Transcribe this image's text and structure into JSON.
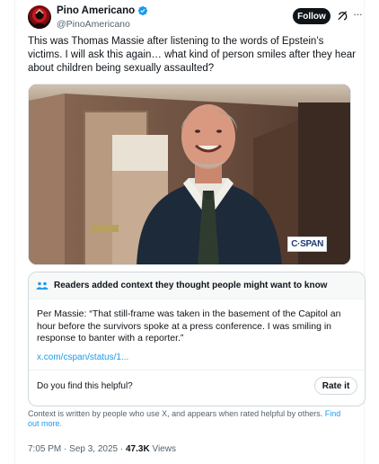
{
  "tweet": {
    "author_name": "Pino Americano",
    "author_handle": "@PinoAmericano",
    "follow_label": "Follow",
    "text": "This was Thomas Massie after listening to the words of Epstein’s victims. I will ask this again… what kind of person smiles after they hear about children being sexually assaulted?",
    "media_watermark": "C·SPAN",
    "time": "7:05 PM",
    "date": "Sep 3, 2025",
    "views_count": "47.3K",
    "views_label": "Views",
    "separator": "·"
  },
  "community_note": {
    "title": "Readers added context they thought people might want to know",
    "body": "Per Massie: “That still-frame was taken in the basement of the Capitol an hour before the survivors spoke at a press conference. I was smiling in response to banter with a reporter.”",
    "link": "x.com/cspan/status/1...",
    "helpful_question": "Do you find this helpful?",
    "rate_label": "Rate it",
    "footer_text": "Context is written by people who use X, and appears when rated helpful by others.",
    "footer_link": "Find out more."
  },
  "colors": {
    "accent": "#1d9bf0",
    "verified": "#1d9bf0",
    "text_primary": "#0f1419",
    "text_secondary": "#536471"
  },
  "icons": [
    "verified-badge-icon",
    "grok-icon",
    "more-options-icon",
    "community-notes-icon"
  ]
}
